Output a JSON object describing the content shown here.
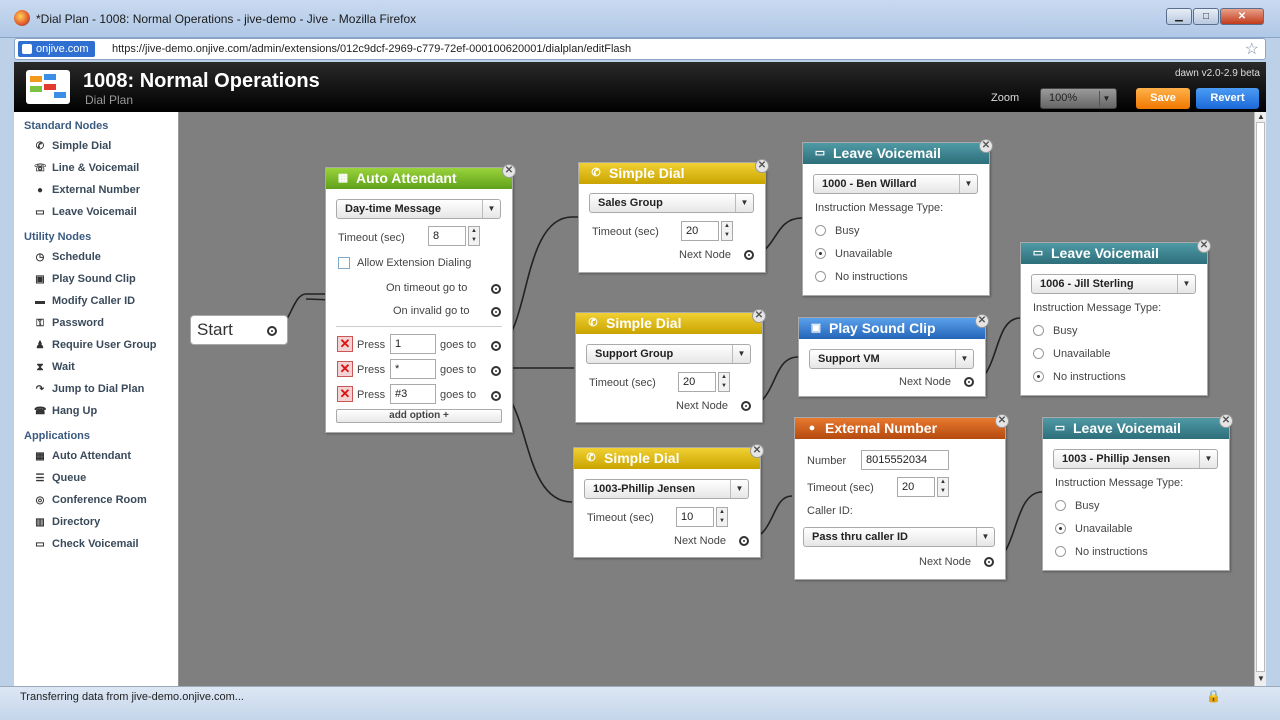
{
  "browser": {
    "title": "*Dial Plan - 1008: Normal Operations - jive-demo - Jive - Mozilla Firefox",
    "site_badge": "onjive.com",
    "url": "https://jive-demo.onjive.com/admin/extensions/012c9dcf-2969-c779-72ef-000100620001/dialplan/editFlash",
    "status": "Transferring data from jive-demo.onjive.com..."
  },
  "header": {
    "title": "1008: Normal Operations",
    "subtitle": "Dial Plan",
    "version": "dawn v2.0-2.9 beta",
    "zoom_label": "Zoom",
    "zoom_value": "100%",
    "save": "Save",
    "revert": "Revert"
  },
  "sidebar": {
    "standard_title": "Standard Nodes",
    "standard": [
      "Simple Dial",
      "Line & Voicemail",
      "External Number",
      "Leave Voicemail"
    ],
    "utility_title": "Utility Nodes",
    "utility": [
      "Schedule",
      "Play Sound Clip",
      "Modify Caller ID",
      "Password",
      "Require User Group",
      "Wait",
      "Jump to Dial Plan",
      "Hang Up"
    ],
    "apps_title": "Applications",
    "apps": [
      "Auto Attendant",
      "Queue",
      "Conference Room",
      "Directory",
      "Check Voicemail"
    ]
  },
  "canvas": {
    "start": "Start",
    "auto_attendant": {
      "title": "Auto Attendant",
      "message": "Day-time Message",
      "timeout_label": "Timeout (sec)",
      "timeout": "8",
      "allow_ext": "Allow Extension Dialing",
      "on_timeout": "On timeout go to",
      "on_invalid": "On invalid go to",
      "press": "Press",
      "goes_to": "goes to",
      "options": [
        "1",
        "*",
        "#3"
      ],
      "add_option": "add option +"
    },
    "simple_dial_1": {
      "title": "Simple Dial",
      "group": "Sales Group",
      "timeout_label": "Timeout (sec)",
      "timeout": "20",
      "next": "Next Node"
    },
    "simple_dial_2": {
      "title": "Simple Dial",
      "group": "Support Group",
      "timeout_label": "Timeout (sec)",
      "timeout": "20",
      "next": "Next Node"
    },
    "simple_dial_3": {
      "title": "Simple Dial",
      "group": "1003-Phillip Jensen",
      "timeout_label": "Timeout (sec)",
      "timeout": "10",
      "next": "Next Node"
    },
    "leave_vm_1": {
      "title": "Leave Voicemail",
      "user": "1000 - Ben Willard",
      "msg_type": "Instruction Message Type:",
      "opts": [
        "Busy",
        "Unavailable",
        "No instructions"
      ]
    },
    "leave_vm_2": {
      "title": "Leave Voicemail",
      "user": "1006 - Jill Sterling",
      "msg_type": "Instruction Message Type:",
      "opts": [
        "Busy",
        "Unavailable",
        "No instructions"
      ]
    },
    "leave_vm_3": {
      "title": "Leave Voicemail",
      "user": "1003 - Phillip Jensen",
      "msg_type": "Instruction Message Type:",
      "opts": [
        "Busy",
        "Unavailable",
        "No instructions"
      ]
    },
    "play_sound": {
      "title": "Play Sound Clip",
      "clip": "Support VM",
      "next": "Next Node"
    },
    "external": {
      "title": "External Number",
      "number_label": "Number",
      "number": "8015552034",
      "timeout_label": "Timeout (sec)",
      "timeout": "20",
      "callerid_label": "Caller ID:",
      "callerid": "Pass thru caller ID",
      "next": "Next Node"
    }
  }
}
